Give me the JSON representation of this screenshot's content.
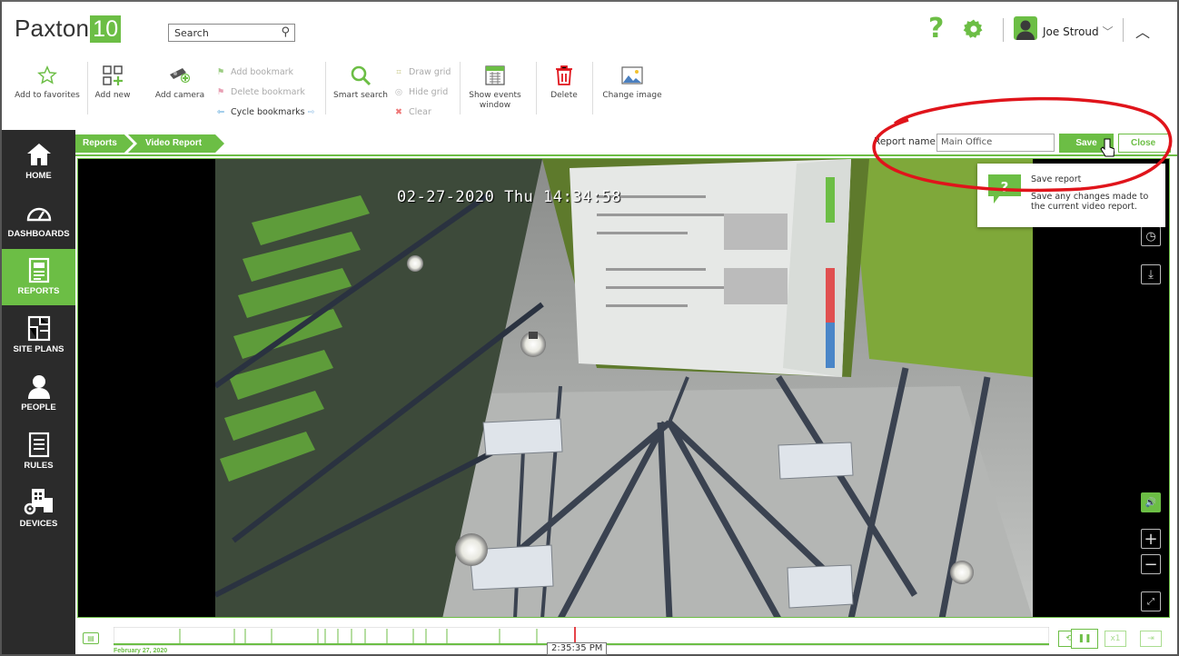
{
  "app": {
    "logo_text": "Paxton",
    "logo_badge": "10"
  },
  "search": {
    "placeholder": "Search",
    "value": "Search"
  },
  "user": {
    "name": "Joe Stroud"
  },
  "toolbar": {
    "add_favorites": "Add to favorites",
    "add_new": "Add new",
    "add_camera": "Add camera",
    "add_bookmark": "Add bookmark",
    "delete_bookmark": "Delete bookmark",
    "cycle_bookmarks": "Cycle bookmarks",
    "smart_search": "Smart search",
    "draw_grid": "Draw grid",
    "hide_grid": "Hide grid",
    "clear": "Clear",
    "show_events_1": "Show events",
    "show_events_2": "window",
    "delete": "Delete",
    "change_image": "Change image"
  },
  "sidebar": {
    "items": [
      {
        "label": "HOME",
        "icon": "home-icon"
      },
      {
        "label": "DASHBOARDS",
        "icon": "dashboard-icon"
      },
      {
        "label": "REPORTS",
        "icon": "reports-icon",
        "active": true
      },
      {
        "label": "SITE PLANS",
        "icon": "site-plans-icon"
      },
      {
        "label": "PEOPLE",
        "icon": "people-icon"
      },
      {
        "label": "RULES",
        "icon": "rules-icon"
      },
      {
        "label": "DEVICES",
        "icon": "devices-icon"
      }
    ]
  },
  "breadcrumb": {
    "items": [
      "Reports",
      "Video Report"
    ]
  },
  "report": {
    "name_label": "Report name",
    "name_value": "Main Office",
    "save_label": "Save",
    "close_label": "Close"
  },
  "video": {
    "osd": "02-27-2020 Thu 14:34:58"
  },
  "tooltip": {
    "title": "Save report",
    "description": "Save any changes made to the current video report."
  },
  "timeline": {
    "date": "February 27, 2020",
    "time": "2:35:35 PM",
    "speed": "x1"
  },
  "colors": {
    "accent": "#6cbe45",
    "sidebar": "#2b2b2b",
    "annotation": "#e0141b"
  }
}
